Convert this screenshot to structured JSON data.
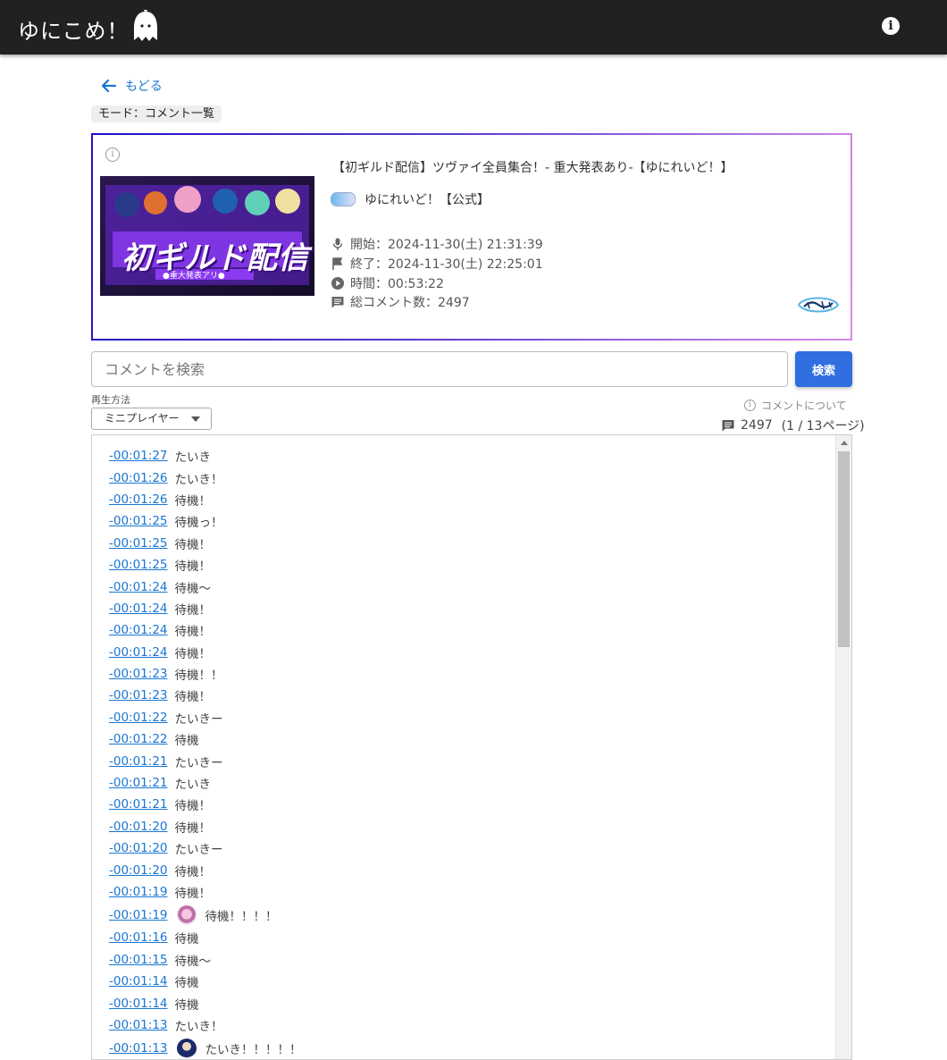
{
  "app": {
    "title": "ゆにこめ！"
  },
  "nav": {
    "back_label": "もどる"
  },
  "mode": {
    "label": "モード：コメント一覧"
  },
  "video": {
    "title": "【初ギルド配信】ツヴァイ全員集合！- 重大発表あり-【ゆにれいど！】",
    "channel": "ゆにれいど！【公式】",
    "start": "開始：2024-11-30(土) 21:31:39",
    "end": "終了：2024-11-30(土) 22:25:01",
    "duration": "時間：00:53:22",
    "total_comments": "総コメント数：2497",
    "thumbnail_text": "初ギルド配信",
    "thumbnail_sub": "●重大発表アリ●"
  },
  "search": {
    "placeholder": "コメントを検索",
    "button": "検索"
  },
  "playback": {
    "label": "再生方法",
    "selected": "ミニプレイヤー"
  },
  "about_link": "コメントについて",
  "comment_count": "2497",
  "pagination": "(1 / 13ページ)",
  "comments": [
    {
      "time": "-00:01:27",
      "text": "たいき"
    },
    {
      "time": "-00:01:26",
      "text": "たいき！"
    },
    {
      "time": "-00:01:26",
      "text": "待機！"
    },
    {
      "time": "-00:01:25",
      "text": "待機っ！"
    },
    {
      "time": "-00:01:25",
      "text": "待機！"
    },
    {
      "time": "-00:01:25",
      "text": "待機！"
    },
    {
      "time": "-00:01:24",
      "text": "待機〜"
    },
    {
      "time": "-00:01:24",
      "text": "待機！"
    },
    {
      "time": "-00:01:24",
      "text": "待機！"
    },
    {
      "time": "-00:01:24",
      "text": "待機！"
    },
    {
      "time": "-00:01:23",
      "text": "待機！！"
    },
    {
      "time": "-00:01:23",
      "text": "待機！"
    },
    {
      "time": "-00:01:22",
      "text": "たいきー"
    },
    {
      "time": "-00:01:22",
      "text": "待機"
    },
    {
      "time": "-00:01:21",
      "text": "たいきー"
    },
    {
      "time": "-00:01:21",
      "text": "たいき"
    },
    {
      "time": "-00:01:21",
      "text": "待機！"
    },
    {
      "time": "-00:01:20",
      "text": "待機！"
    },
    {
      "time": "-00:01:20",
      "text": "たいきー"
    },
    {
      "time": "-00:01:20",
      "text": "待機！"
    },
    {
      "time": "-00:01:19",
      "text": "待機！"
    },
    {
      "time": "-00:01:19",
      "text": "待機！！！！"
    },
    {
      "time": "-00:01:16",
      "text": "待機"
    },
    {
      "time": "-00:01:15",
      "text": "待機〜"
    },
    {
      "time": "-00:01:14",
      "text": "待機"
    },
    {
      "time": "-00:01:14",
      "text": "待機"
    },
    {
      "time": "-00:01:13",
      "text": "たいき！"
    },
    {
      "time": "-00:01:13",
      "text": "たいき！！！！！"
    }
  ],
  "colors": {
    "appbar": "#212121",
    "accent": "#1976d2",
    "search_button": "#2f6fe0"
  }
}
